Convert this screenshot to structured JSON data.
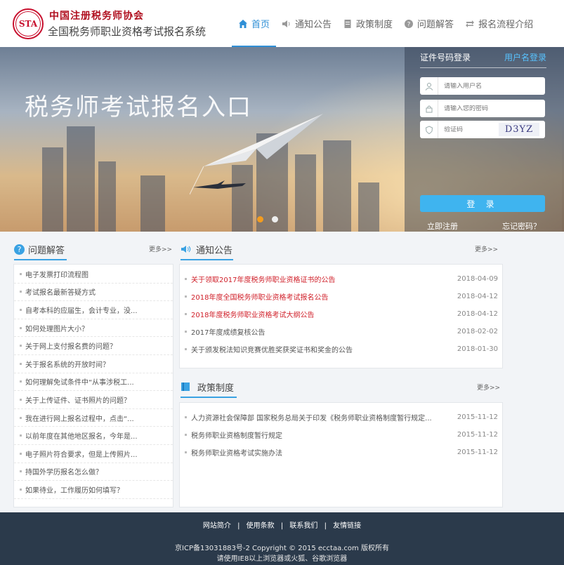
{
  "header": {
    "logo_text": "中国注册税务师协会",
    "logo_emblem": "STA",
    "system_title": "全国税务师职业资格考试报名系统",
    "nav": [
      {
        "label": "首页",
        "icon": "home-icon"
      },
      {
        "label": "通知公告",
        "icon": "speaker-icon"
      },
      {
        "label": "政策制度",
        "icon": "document-icon"
      },
      {
        "label": "问题解答",
        "icon": "question-icon"
      },
      {
        "label": "报名流程介绍",
        "icon": "flow-icon"
      }
    ]
  },
  "banner": {
    "title": "税务师考试报名入口",
    "active_slide": 1,
    "slide_count": 2
  },
  "login": {
    "tab_id": "证件号码登录",
    "tab_user": "用户名登录",
    "username_placeholder": "请输入用户名",
    "password_placeholder": "请输入您的密码",
    "captcha_placeholder": "验证码",
    "captcha_text": "D3YZ",
    "login_button": "登 录",
    "register_link": "立即注册",
    "forgot_link": "忘记密码？"
  },
  "faq": {
    "title": "问题解答",
    "more": "更多>>",
    "items": [
      "电子发票打印流程图",
      "考试报名最新答疑方式",
      "自考本科的应届生，会计专业，没...",
      "如何处理图片大小？",
      "关于网上支付报名费的问题？",
      "关于报名系统的开放时间？",
      "如何理解免试条件中“从事涉税工...",
      "关于上传证件、证书照片的问题？",
      "我在进行网上报名过程中，点击“...",
      "以前年度在其他地区报名，今年是...",
      "电子照片符合要求，但是上传照片...",
      "持国外学历报名怎么做？",
      "如果待业，工作履历如何填写？"
    ]
  },
  "notices": {
    "title": "通知公告",
    "more": "更多>>",
    "items": [
      {
        "title": "关于领取2017年度税务师职业资格证书的公告",
        "date": "2018-04-09",
        "highlight": true
      },
      {
        "title": "2018年度全国税务师职业资格考试报名公告",
        "date": "2018-04-12",
        "highlight": true
      },
      {
        "title": "2018年度税务师职业资格考试大纲公告",
        "date": "2018-04-12",
        "highlight": true
      },
      {
        "title": "2017年度成绩复核公告",
        "date": "2018-02-02",
        "highlight": false
      },
      {
        "title": "关于颁发税法知识竞赛优胜奖获奖证书和奖金的公告",
        "date": "2018-01-30",
        "highlight": false
      }
    ]
  },
  "policy": {
    "title": "政策制度",
    "more": "更多>>",
    "items": [
      {
        "title": "人力资源社会保障部 国家税务总局关于印发《税务师职业资格制度暂行规定...",
        "date": "2015-11-12"
      },
      {
        "title": "税务师职业资格制度暂行规定",
        "date": "2015-11-12"
      },
      {
        "title": "税务师职业资格考试实施办法",
        "date": "2015-11-12"
      }
    ]
  },
  "footer": {
    "links": [
      "网站简介",
      "使用条款",
      "联系我们",
      "友情链接"
    ],
    "separator": "|",
    "copyright": "京ICP备13031883号-2 Copyright © 2015 ecctaa.com 版权所有",
    "browser_note": "请使用IE8以上浏览器或火狐、谷歌浏览器"
  },
  "colors": {
    "accent": "#2f8fd6",
    "login_button": "#3fb4ef",
    "highlight_red": "#d0202a",
    "footer_bg": "#2b3a4b",
    "slide_active": "#f39c1f"
  }
}
